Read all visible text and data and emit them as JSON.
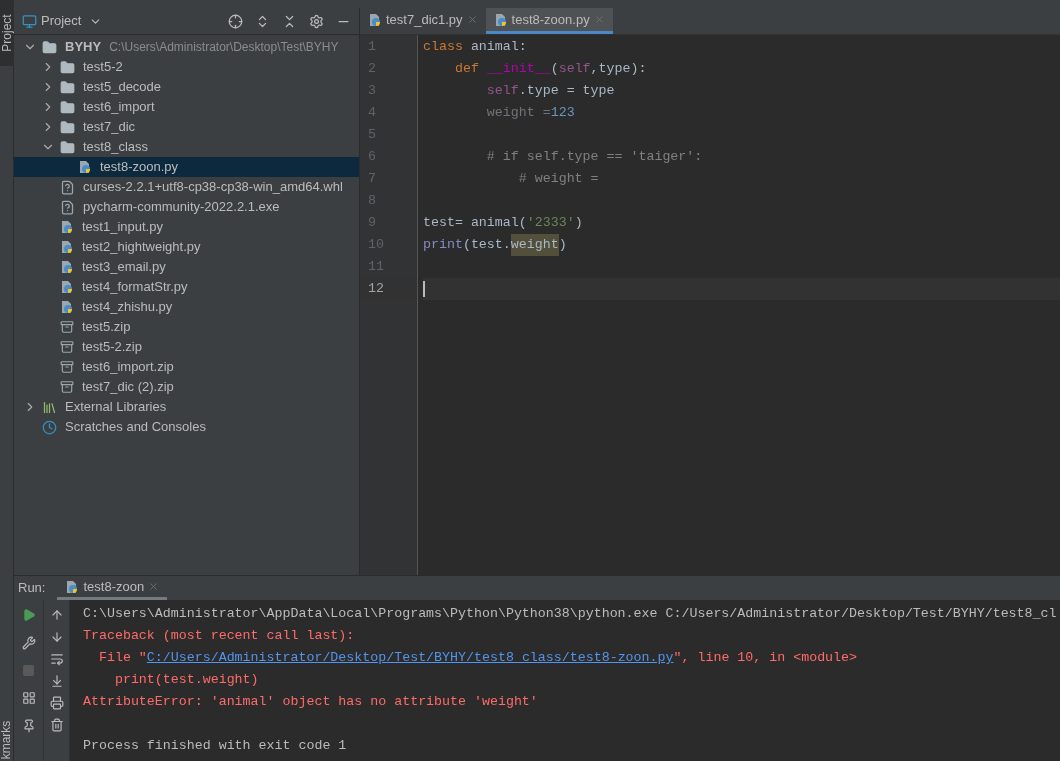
{
  "side_tabs": [
    "Project"
  ],
  "bottom_side_tabs": [
    "kmarks"
  ],
  "project": {
    "title": "Project",
    "tree": [
      {
        "label": "BYHY",
        "path": "C:\\Users\\Administrator\\Desktop\\Test\\BYHY",
        "kind": "root",
        "expanded": true,
        "selected": false,
        "children": [
          {
            "label": "test5-2",
            "kind": "folder",
            "expanded": false,
            "selected": false
          },
          {
            "label": "test5_decode",
            "kind": "folder",
            "expanded": false,
            "selected": false
          },
          {
            "label": "test6_import",
            "kind": "folder",
            "expanded": false,
            "selected": false
          },
          {
            "label": "test7_dic",
            "kind": "folder",
            "expanded": false,
            "selected": false
          },
          {
            "label": "test8_class",
            "kind": "folder",
            "expanded": true,
            "selected": false,
            "children": [
              {
                "label": "test8-zoon.py",
                "kind": "python",
                "selected": true
              }
            ]
          },
          {
            "label": "curses-2.2.1+utf8-cp38-cp38-win_amd64.whl",
            "kind": "unknown",
            "selected": false
          },
          {
            "label": "pycharm-community-2022.2.1.exe",
            "kind": "unknown",
            "selected": false
          },
          {
            "label": "test1_input.py",
            "kind": "python",
            "selected": false
          },
          {
            "label": "test2_hightweight.py",
            "kind": "python",
            "selected": false
          },
          {
            "label": "test3_email.py",
            "kind": "python",
            "selected": false
          },
          {
            "label": "test4_formatStr.py",
            "kind": "python",
            "selected": false
          },
          {
            "label": "test4_zhishu.py",
            "kind": "python",
            "selected": false
          },
          {
            "label": "test5.zip",
            "kind": "zip",
            "selected": false
          },
          {
            "label": "test5-2.zip",
            "kind": "zip",
            "selected": false
          },
          {
            "label": "test6_import.zip",
            "kind": "zip",
            "selected": false
          },
          {
            "label": "test7_dic (2).zip",
            "kind": "zip",
            "selected": false
          }
        ]
      },
      {
        "label": "External Libraries",
        "kind": "libraries",
        "expanded": false,
        "selected": false
      },
      {
        "label": "Scratches and Consoles",
        "kind": "scratches",
        "selected": false
      }
    ]
  },
  "editor": {
    "tabs": [
      {
        "label": "test7_dic1.py",
        "selected": false
      },
      {
        "label": "test8-zoon.py",
        "selected": true
      }
    ],
    "lines": [
      {
        "number": "1",
        "current": false,
        "tokens": [
          {
            "text": "class",
            "kind": "keyword"
          },
          {
            "text": " animal:",
            "kind": "plain"
          }
        ]
      },
      {
        "number": "2",
        "current": false,
        "tokens": [
          {
            "text": "    def",
            "kind": "keyword"
          },
          {
            "text": " __init__",
            "kind": "magic"
          },
          {
            "text": "(",
            "kind": "plain"
          },
          {
            "text": "self",
            "kind": "self"
          },
          {
            "text": ",type):",
            "kind": "plain"
          }
        ]
      },
      {
        "number": "3",
        "current": false,
        "tokens": [
          {
            "text": "        self",
            "kind": "self"
          },
          {
            "text": ".type = type",
            "kind": "plain"
          }
        ]
      },
      {
        "number": "4",
        "current": false,
        "tokens": [
          {
            "text": "        weight =",
            "kind": "unused"
          },
          {
            "text": "123",
            "kind": "number"
          }
        ]
      },
      {
        "number": "5",
        "current": false
      },
      {
        "number": "6",
        "current": false,
        "tokens": [
          {
            "text": "        # if self.type == 'taiger':",
            "kind": "comment"
          }
        ]
      },
      {
        "number": "7",
        "current": false,
        "tokens": [
          {
            "text": "            # weight =",
            "kind": "comment"
          }
        ]
      },
      {
        "number": "8",
        "current": false
      },
      {
        "number": "9",
        "current": false,
        "tokens": [
          {
            "text": "test= animal(",
            "kind": "plain"
          },
          {
            "text": "'2333'",
            "kind": "string"
          },
          {
            "text": ")",
            "kind": "plain"
          }
        ]
      },
      {
        "number": "10",
        "current": false,
        "tokens": [
          {
            "text": "print",
            "kind": "builtin"
          },
          {
            "text": "(test.",
            "kind": "plain"
          },
          {
            "text": "weight",
            "kind": "highlight"
          },
          {
            "text": ")",
            "kind": "plain"
          }
        ]
      },
      {
        "number": "11",
        "current": false
      },
      {
        "number": "12",
        "current": true
      }
    ]
  },
  "run": {
    "label": "Run:",
    "tabs": [
      {
        "label": "test8-zoon",
        "selected": true
      }
    ],
    "console": [
      {
        "tokens": [
          {
            "text": "C:\\Users\\Administrator\\AppData\\Local\\Programs\\Python\\Python38\\python.exe C:/Users/Administrator/Desktop/Test/BYHY/test8_cl",
            "kind": "plain"
          }
        ]
      },
      {
        "tokens": [
          {
            "text": "Traceback (most recent call last):",
            "kind": "error"
          }
        ]
      },
      {
        "tokens": [
          {
            "text": "  File \"",
            "kind": "error"
          },
          {
            "text": "C:/Users/Administrator/Desktop/Test/BYHY/test8_class/test8-zoon.py",
            "kind": "link"
          },
          {
            "text": "\", line 10, in <module>",
            "kind": "error"
          }
        ]
      },
      {
        "tokens": [
          {
            "text": "    print(test.weight)",
            "kind": "error"
          }
        ]
      },
      {
        "tokens": [
          {
            "text": "AttributeError: 'animal' object has no attribute 'weight'",
            "kind": "error"
          }
        ]
      },
      {
        "spaced": true,
        "tokens": [
          {
            "text": "Process finished with exit code 1",
            "kind": "plain"
          }
        ]
      }
    ]
  }
}
